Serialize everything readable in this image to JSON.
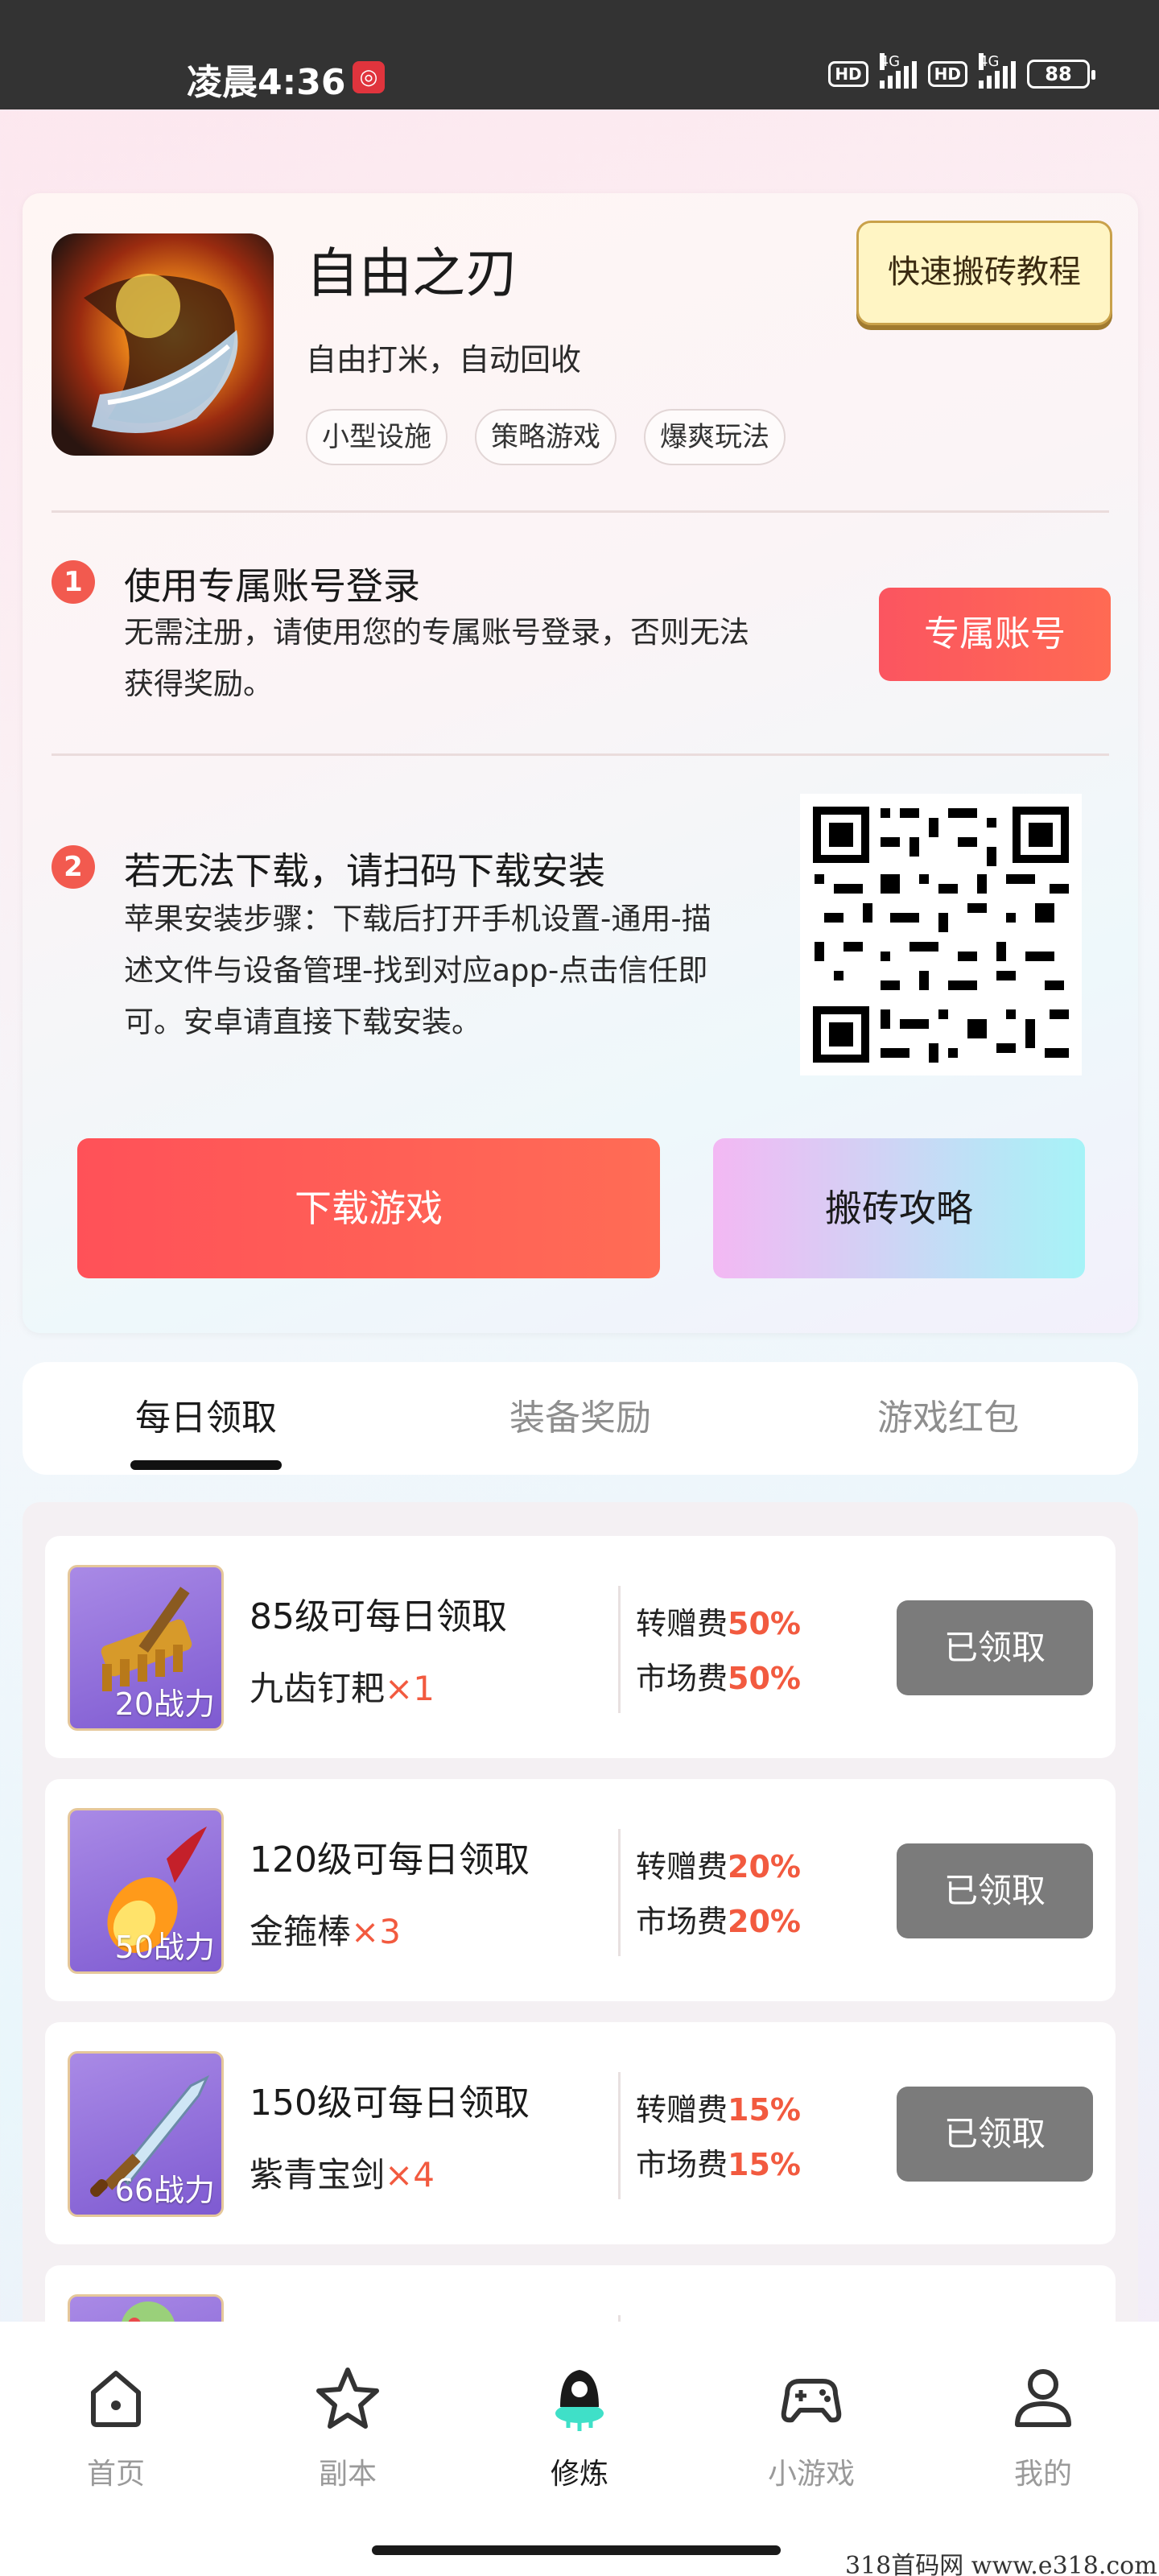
{
  "status_bar": {
    "time": "凌晨4:36",
    "notification_badge": "◎",
    "hd1": "HD",
    "net1": "4G",
    "hd2": "HD",
    "net2": "4G",
    "battery": "88"
  },
  "game": {
    "title": "自由之刃",
    "subtitle": "自由打米，自动回收",
    "tags": [
      "小型设施",
      "策略游戏",
      "爆爽玩法"
    ],
    "tutorial_button": "快速搬砖教程"
  },
  "steps": [
    {
      "number": "1",
      "title": "使用专属账号登录",
      "desc_lines": [
        "无需注册，请使用您的专属账号登录，否则无法",
        "获得奖励。"
      ],
      "button": "专属账号"
    },
    {
      "number": "2",
      "title": "若无法下载，请扫码下载安装",
      "desc_lines": [
        "苹果安装步骤：下载后打开手机设置-通用-描",
        "述文件与设备管理-找到对应app-点击信任即",
        "可。安卓请直接下载安装。"
      ]
    }
  ],
  "actions": {
    "download": "下载游戏",
    "guide": "搬砖攻略"
  },
  "tabs": [
    {
      "label": "每日领取",
      "active": true
    },
    {
      "label": "装备奖励",
      "active": false
    },
    {
      "label": "游戏红包",
      "active": false
    }
  ],
  "rewards": [
    {
      "power": "20战力",
      "level": "85级可每日领取",
      "name": "九齿钉耙",
      "qty": "×1",
      "transfer_label": "转赠费",
      "transfer_pct": "50%",
      "market_label": "市场费",
      "market_pct": "50%",
      "button": "已领取"
    },
    {
      "power": "50战力",
      "level": "120级可每日领取",
      "name": "金箍棒",
      "qty": "×3",
      "transfer_label": "转赠费",
      "transfer_pct": "20%",
      "market_label": "市场费",
      "market_pct": "20%",
      "button": "已领取"
    },
    {
      "power": "66战力",
      "level": "150级可每日领取",
      "name": "紫青宝剑",
      "qty": "×4",
      "transfer_label": "转赠费",
      "transfer_pct": "15%",
      "market_label": "市场费",
      "market_pct": "15%",
      "button": "已领取"
    }
  ],
  "nav": [
    {
      "label": "首页",
      "icon": "home-icon",
      "active": false
    },
    {
      "label": "副本",
      "icon": "star-icon",
      "active": false
    },
    {
      "label": "修炼",
      "icon": "rocket-icon",
      "active": true
    },
    {
      "label": "小游戏",
      "icon": "gamepad-icon",
      "active": false
    },
    {
      "label": "我的",
      "icon": "user-icon",
      "active": false
    }
  ],
  "watermark": "318首码网  www.e318.com",
  "colors": {
    "accent_red": "#f25a4f",
    "qty_orange": "#f25a3f",
    "claimed_gray": "#7b7b7b",
    "nav_active_teal": "#3fe0c8"
  }
}
